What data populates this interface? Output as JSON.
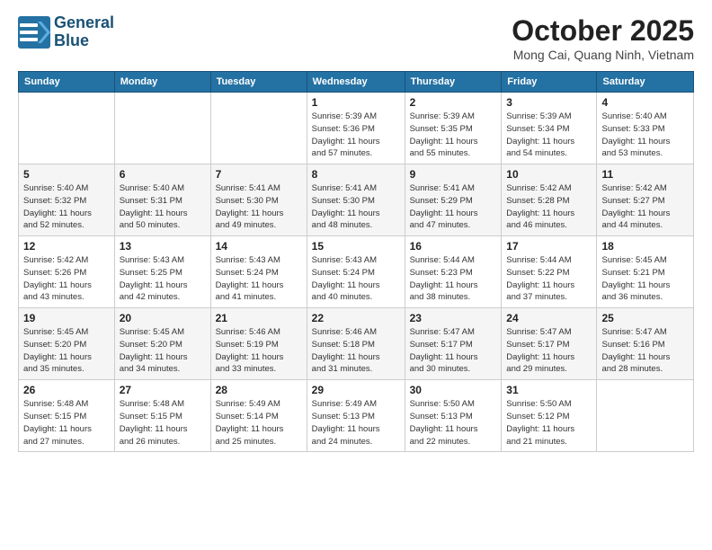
{
  "logo": {
    "line1": "General",
    "line2": "Blue"
  },
  "title": "October 2025",
  "location": "Mong Cai, Quang Ninh, Vietnam",
  "days_of_week": [
    "Sunday",
    "Monday",
    "Tuesday",
    "Wednesday",
    "Thursday",
    "Friday",
    "Saturday"
  ],
  "weeks": [
    [
      {
        "day": "",
        "info": ""
      },
      {
        "day": "",
        "info": ""
      },
      {
        "day": "",
        "info": ""
      },
      {
        "day": "1",
        "info": "Sunrise: 5:39 AM\nSunset: 5:36 PM\nDaylight: 11 hours\nand 57 minutes."
      },
      {
        "day": "2",
        "info": "Sunrise: 5:39 AM\nSunset: 5:35 PM\nDaylight: 11 hours\nand 55 minutes."
      },
      {
        "day": "3",
        "info": "Sunrise: 5:39 AM\nSunset: 5:34 PM\nDaylight: 11 hours\nand 54 minutes."
      },
      {
        "day": "4",
        "info": "Sunrise: 5:40 AM\nSunset: 5:33 PM\nDaylight: 11 hours\nand 53 minutes."
      }
    ],
    [
      {
        "day": "5",
        "info": "Sunrise: 5:40 AM\nSunset: 5:32 PM\nDaylight: 11 hours\nand 52 minutes."
      },
      {
        "day": "6",
        "info": "Sunrise: 5:40 AM\nSunset: 5:31 PM\nDaylight: 11 hours\nand 50 minutes."
      },
      {
        "day": "7",
        "info": "Sunrise: 5:41 AM\nSunset: 5:30 PM\nDaylight: 11 hours\nand 49 minutes."
      },
      {
        "day": "8",
        "info": "Sunrise: 5:41 AM\nSunset: 5:30 PM\nDaylight: 11 hours\nand 48 minutes."
      },
      {
        "day": "9",
        "info": "Sunrise: 5:41 AM\nSunset: 5:29 PM\nDaylight: 11 hours\nand 47 minutes."
      },
      {
        "day": "10",
        "info": "Sunrise: 5:42 AM\nSunset: 5:28 PM\nDaylight: 11 hours\nand 46 minutes."
      },
      {
        "day": "11",
        "info": "Sunrise: 5:42 AM\nSunset: 5:27 PM\nDaylight: 11 hours\nand 44 minutes."
      }
    ],
    [
      {
        "day": "12",
        "info": "Sunrise: 5:42 AM\nSunset: 5:26 PM\nDaylight: 11 hours\nand 43 minutes."
      },
      {
        "day": "13",
        "info": "Sunrise: 5:43 AM\nSunset: 5:25 PM\nDaylight: 11 hours\nand 42 minutes."
      },
      {
        "day": "14",
        "info": "Sunrise: 5:43 AM\nSunset: 5:24 PM\nDaylight: 11 hours\nand 41 minutes."
      },
      {
        "day": "15",
        "info": "Sunrise: 5:43 AM\nSunset: 5:24 PM\nDaylight: 11 hours\nand 40 minutes."
      },
      {
        "day": "16",
        "info": "Sunrise: 5:44 AM\nSunset: 5:23 PM\nDaylight: 11 hours\nand 38 minutes."
      },
      {
        "day": "17",
        "info": "Sunrise: 5:44 AM\nSunset: 5:22 PM\nDaylight: 11 hours\nand 37 minutes."
      },
      {
        "day": "18",
        "info": "Sunrise: 5:45 AM\nSunset: 5:21 PM\nDaylight: 11 hours\nand 36 minutes."
      }
    ],
    [
      {
        "day": "19",
        "info": "Sunrise: 5:45 AM\nSunset: 5:20 PM\nDaylight: 11 hours\nand 35 minutes."
      },
      {
        "day": "20",
        "info": "Sunrise: 5:45 AM\nSunset: 5:20 PM\nDaylight: 11 hours\nand 34 minutes."
      },
      {
        "day": "21",
        "info": "Sunrise: 5:46 AM\nSunset: 5:19 PM\nDaylight: 11 hours\nand 33 minutes."
      },
      {
        "day": "22",
        "info": "Sunrise: 5:46 AM\nSunset: 5:18 PM\nDaylight: 11 hours\nand 31 minutes."
      },
      {
        "day": "23",
        "info": "Sunrise: 5:47 AM\nSunset: 5:17 PM\nDaylight: 11 hours\nand 30 minutes."
      },
      {
        "day": "24",
        "info": "Sunrise: 5:47 AM\nSunset: 5:17 PM\nDaylight: 11 hours\nand 29 minutes."
      },
      {
        "day": "25",
        "info": "Sunrise: 5:47 AM\nSunset: 5:16 PM\nDaylight: 11 hours\nand 28 minutes."
      }
    ],
    [
      {
        "day": "26",
        "info": "Sunrise: 5:48 AM\nSunset: 5:15 PM\nDaylight: 11 hours\nand 27 minutes."
      },
      {
        "day": "27",
        "info": "Sunrise: 5:48 AM\nSunset: 5:15 PM\nDaylight: 11 hours\nand 26 minutes."
      },
      {
        "day": "28",
        "info": "Sunrise: 5:49 AM\nSunset: 5:14 PM\nDaylight: 11 hours\nand 25 minutes."
      },
      {
        "day": "29",
        "info": "Sunrise: 5:49 AM\nSunset: 5:13 PM\nDaylight: 11 hours\nand 24 minutes."
      },
      {
        "day": "30",
        "info": "Sunrise: 5:50 AM\nSunset: 5:13 PM\nDaylight: 11 hours\nand 22 minutes."
      },
      {
        "day": "31",
        "info": "Sunrise: 5:50 AM\nSunset: 5:12 PM\nDaylight: 11 hours\nand 21 minutes."
      },
      {
        "day": "",
        "info": ""
      }
    ]
  ]
}
